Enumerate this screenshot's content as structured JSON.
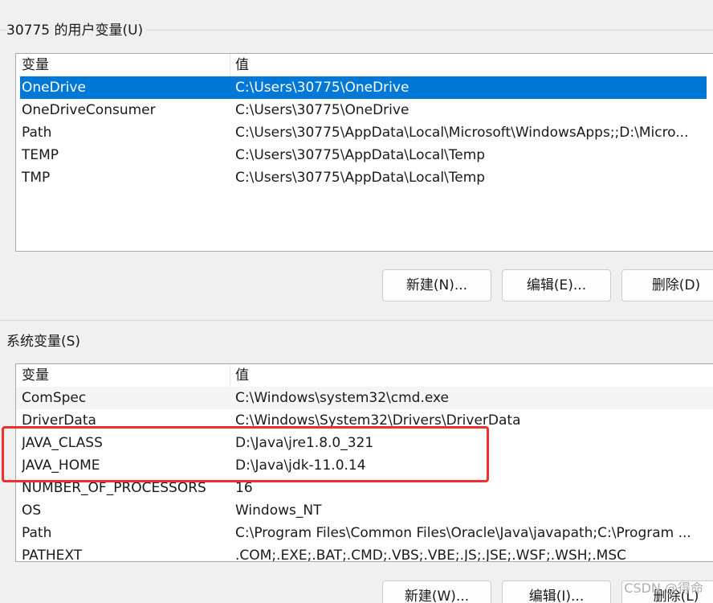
{
  "user_vars": {
    "title": "30775 的用户变量(U)",
    "col_name": "变量",
    "col_value": "值",
    "rows": [
      {
        "name": "OneDrive",
        "value": "C:\\Users\\30775\\OneDrive",
        "selected": true
      },
      {
        "name": "OneDriveConsumer",
        "value": "C:\\Users\\30775\\OneDrive"
      },
      {
        "name": "Path",
        "value": "C:\\Users\\30775\\AppData\\Local\\Microsoft\\WindowsApps;;D:\\Micro..."
      },
      {
        "name": "TEMP",
        "value": "C:\\Users\\30775\\AppData\\Local\\Temp"
      },
      {
        "name": "TMP",
        "value": "C:\\Users\\30775\\AppData\\Local\\Temp"
      }
    ],
    "buttons": {
      "new": "新建(N)...",
      "edit": "编辑(E)...",
      "delete": "删除(D)"
    }
  },
  "system_vars": {
    "title": "系统变量(S)",
    "col_name": "变量",
    "col_value": "值",
    "rows": [
      {
        "name": "ComSpec",
        "value": "C:\\Windows\\system32\\cmd.exe"
      },
      {
        "name": "DriverData",
        "value": "C:\\Windows\\System32\\Drivers\\DriverData"
      },
      {
        "name": "JAVA_CLASS",
        "value": "D:\\Java\\jre1.8.0_321"
      },
      {
        "name": "JAVA_HOME",
        "value": "D:\\Java\\jdk-11.0.14"
      },
      {
        "name": "NUMBER_OF_PROCESSORS",
        "value": "16"
      },
      {
        "name": "OS",
        "value": "Windows_NT"
      },
      {
        "name": "Path",
        "value": "C:\\Program Files\\Common Files\\Oracle\\Java\\javapath;C:\\Program ..."
      },
      {
        "name": "PATHEXT",
        "value": ".COM;.EXE;.BAT;.CMD;.VBS;.VBE;.JS;.JSE;.WSF;.WSH;.MSC"
      }
    ],
    "buttons": {
      "new": "新建(W)...",
      "edit": "编辑(I)...",
      "delete": "删除(L)"
    }
  },
  "watermark": "CSDN @得命",
  "colors": {
    "selection": "#0078d7",
    "annotation_box": "#f0302c"
  }
}
